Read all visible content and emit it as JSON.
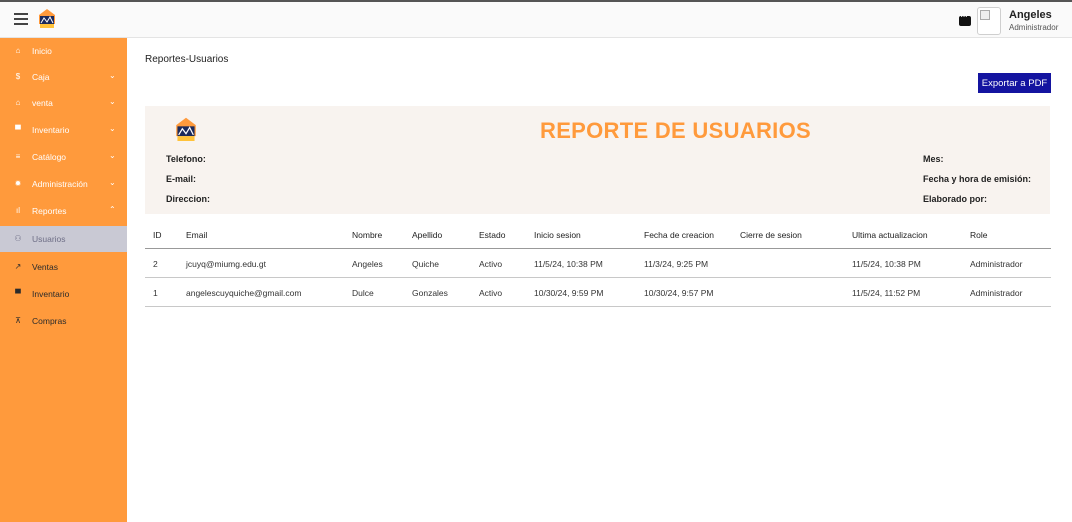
{
  "topbar": {
    "menu_icon": "hamburger-menu-icon",
    "chat_icon": "chat-icon",
    "user_name": "Angeles",
    "user_role": "Administrador"
  },
  "sidebar": {
    "items": [
      {
        "label": "Inicio",
        "icon": "home-icon",
        "glyph": "⌂",
        "chevron": ""
      },
      {
        "label": "Caja",
        "icon": "dollar-icon",
        "glyph": "$",
        "chevron": "⌄"
      },
      {
        "label": "venta",
        "icon": "home-icon",
        "glyph": "⌂",
        "chevron": "⌄"
      },
      {
        "label": "Inventario",
        "icon": "box-icon",
        "glyph": "▀",
        "chevron": "⌄"
      },
      {
        "label": "Catálogo",
        "icon": "list-icon",
        "glyph": "≡",
        "chevron": "⌄"
      },
      {
        "label": "Administración",
        "icon": "gear-icon",
        "glyph": "✹",
        "chevron": "⌄"
      },
      {
        "label": "Reportes",
        "icon": "bar-chart-icon",
        "glyph": "ıl",
        "chevron": "⌃"
      },
      {
        "label": "Usuarios",
        "icon": "users-icon",
        "glyph": "⚇",
        "chevron": ""
      },
      {
        "label": "Ventas",
        "icon": "trend-icon",
        "glyph": "↗",
        "chevron": ""
      },
      {
        "label": "Inventario",
        "icon": "box-icon",
        "glyph": "▀",
        "chevron": ""
      },
      {
        "label": "Compras",
        "icon": "cart-icon",
        "glyph": "⊼",
        "chevron": ""
      }
    ]
  },
  "main": {
    "breadcrumb": "Reportes-Usuarios",
    "export_button": "Exportar a PDF"
  },
  "report": {
    "title": "REPORTE DE USUARIOS",
    "telefono_label": "Telefono:",
    "email_label": "E-mail:",
    "direccion_label": "Direccion:",
    "mes_label": "Mes:",
    "fecha_label": "Fecha y hora de emisión:",
    "elaborado_label": "Elaborado por:"
  },
  "table": {
    "headers": [
      "ID",
      "Email",
      "Nombre",
      "Apellido",
      "Estado",
      "Inicio sesion",
      "Fecha de creacion",
      "Cierre de sesion",
      "Ultima actualizacion",
      "Role"
    ],
    "rows": [
      [
        "2",
        "jcuyq@miumg.edu.gt",
        "Angeles",
        "Quiche",
        "Activo",
        "11/5/24, 10:38 PM",
        "11/3/24, 9:25 PM",
        "",
        "11/5/24, 10:38 PM",
        "Administrador"
      ],
      [
        "1",
        "angelescuyquiche@gmail.com",
        "Dulce",
        "Gonzales",
        "Activo",
        "10/30/24, 9:59 PM",
        "10/30/24, 9:57 PM",
        "",
        "11/5/24, 11:52 PM",
        "Administrador"
      ]
    ]
  },
  "colors": {
    "sidebar": "#ff9a3c",
    "accent_title": "#ff9a3c",
    "export_button": "#1414a0",
    "active_item": "#c9c9d4"
  }
}
